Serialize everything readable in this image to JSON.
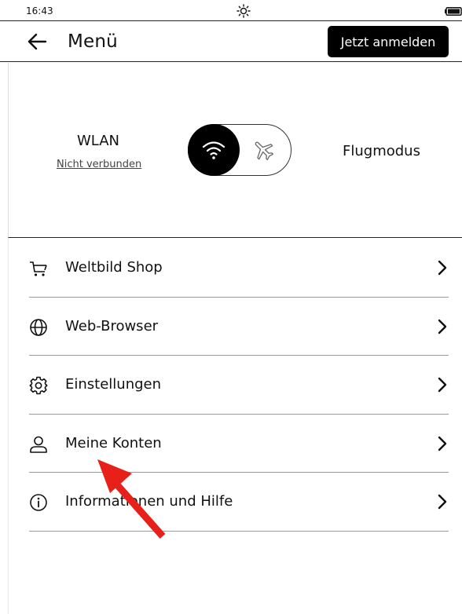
{
  "status_bar": {
    "time": "16:43",
    "icons": [
      "sun-icon",
      "battery-icon"
    ]
  },
  "header": {
    "back_icon": "arrow-left-icon",
    "title": "Menü",
    "login_button": "Jetzt anmelden"
  },
  "connectivity": {
    "wlan_label": "WLAN",
    "wlan_status": "Nicht verbunden",
    "toggle_state": "wifi",
    "airplane_label": "Flugmodus"
  },
  "menu": {
    "items": [
      {
        "label": "Weltbild Shop",
        "icon": "cart-icon"
      },
      {
        "label": "Web-Browser",
        "icon": "globe-icon"
      },
      {
        "label": "Einstellungen",
        "icon": "gear-icon"
      },
      {
        "label": "Meine Konten",
        "icon": "user-icon"
      },
      {
        "label": "Informationen und Hilfe",
        "icon": "info-icon"
      }
    ]
  },
  "annotation": {
    "type": "red-arrow",
    "color": "#e8201a",
    "points_to": "Meine Konten"
  }
}
